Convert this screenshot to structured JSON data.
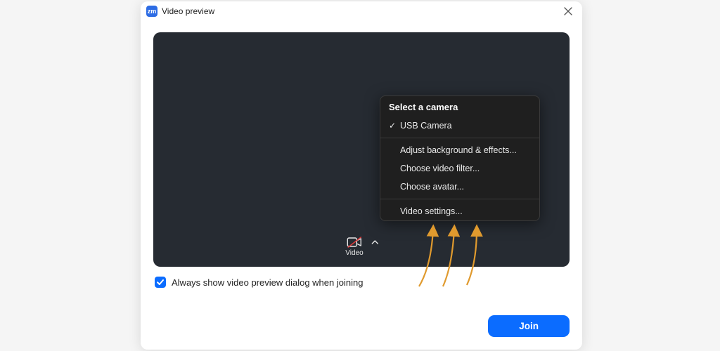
{
  "title": "Video preview",
  "app_icon_label": "zm",
  "video_control": {
    "label": "Video"
  },
  "menu": {
    "header": "Select a camera",
    "camera_selected": "USB Camera",
    "items": [
      "Adjust background & effects...",
      "Choose video filter...",
      "Choose avatar..."
    ],
    "settings_item": "Video settings..."
  },
  "checkbox_label": "Always show video preview dialog when joining",
  "join_button": "Join"
}
